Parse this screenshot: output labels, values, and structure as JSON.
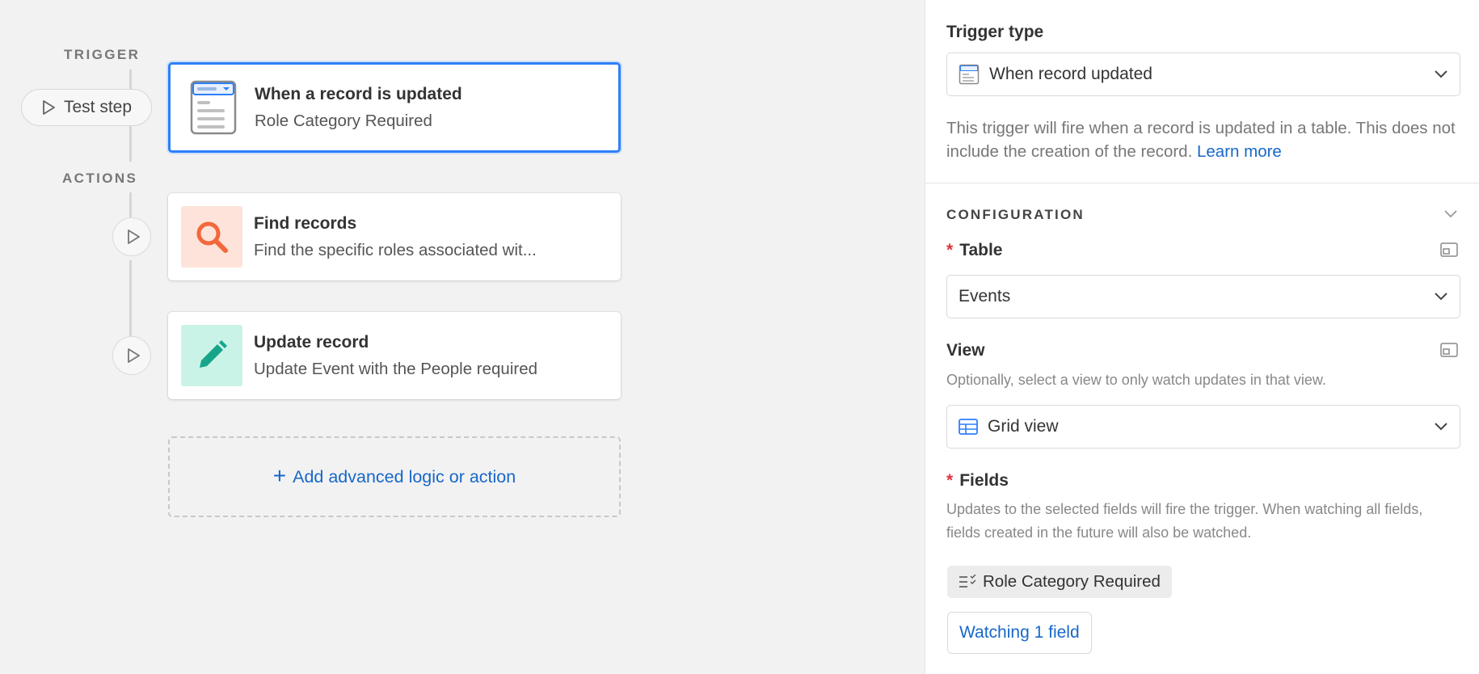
{
  "canvas": {
    "trigger_label": "TRIGGER",
    "actions_label": "ACTIONS",
    "test_step_label": "Test step",
    "trigger_card": {
      "title": "When a record is updated",
      "subtitle": "Role Category Required",
      "icon": "record-updated-icon"
    },
    "actions": [
      {
        "title": "Find records",
        "subtitle": "Find the specific roles associated wit...",
        "icon": "search-icon",
        "color": "#f2683c",
        "bg": "#fde3d9"
      },
      {
        "title": "Update record",
        "subtitle": "Update Event with the People required",
        "icon": "pencil-icon",
        "color": "#17a589",
        "bg": "#c9f3e6"
      }
    ],
    "add_action_label": "Add advanced logic or action"
  },
  "panel": {
    "trigger_type_label": "Trigger type",
    "trigger_type_value": "When record updated",
    "trigger_description": "This trigger will fire when a record is updated in a table. This does not include the creation of the record.",
    "learn_more": "Learn more",
    "configuration_heading": "CONFIGURATION",
    "table_label": "Table",
    "table_value": "Events",
    "view_label": "View",
    "view_help": "Optionally, select a view to only watch updates in that view.",
    "view_value": "Grid view",
    "fields_label": "Fields",
    "fields_help": "Updates to the selected fields will fire the trigger. When watching all fields, fields created in the future will also be watched.",
    "field_chip": "Role Category Required",
    "watching_button": "Watching 1 field",
    "required_marker": "*"
  },
  "colors": {
    "accent": "#2d7ff9",
    "link": "#1767c9",
    "required": "#e0343f"
  }
}
